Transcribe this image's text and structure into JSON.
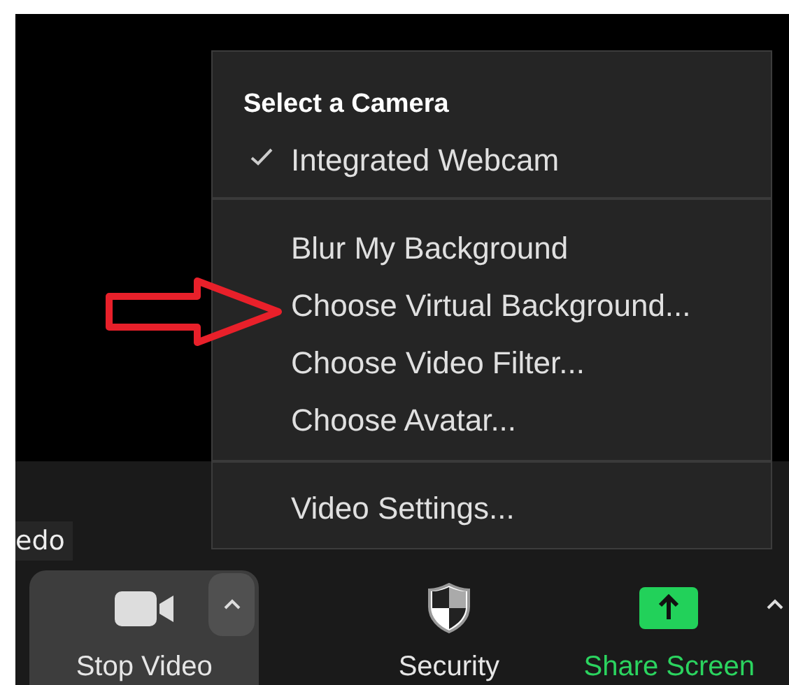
{
  "menu": {
    "title": "Select a Camera",
    "cameras": [
      {
        "label": "Integrated Webcam",
        "checked": true
      }
    ],
    "items": [
      {
        "label": "Blur My Background"
      },
      {
        "label": "Choose Virtual Background..."
      },
      {
        "label": "Choose Video Filter..."
      },
      {
        "label": "Choose Avatar..."
      }
    ],
    "settings": [
      {
        "label": "Video Settings..."
      }
    ]
  },
  "name_tag": "edo",
  "toolbar": [
    {
      "kind": "video",
      "label": "Stop Video",
      "highlighted": true,
      "caret": true
    },
    {
      "kind": "security",
      "label": "Security",
      "highlighted": false,
      "caret": false
    },
    {
      "kind": "share",
      "label": "Share Screen",
      "highlighted": false,
      "caret": true
    }
  ]
}
